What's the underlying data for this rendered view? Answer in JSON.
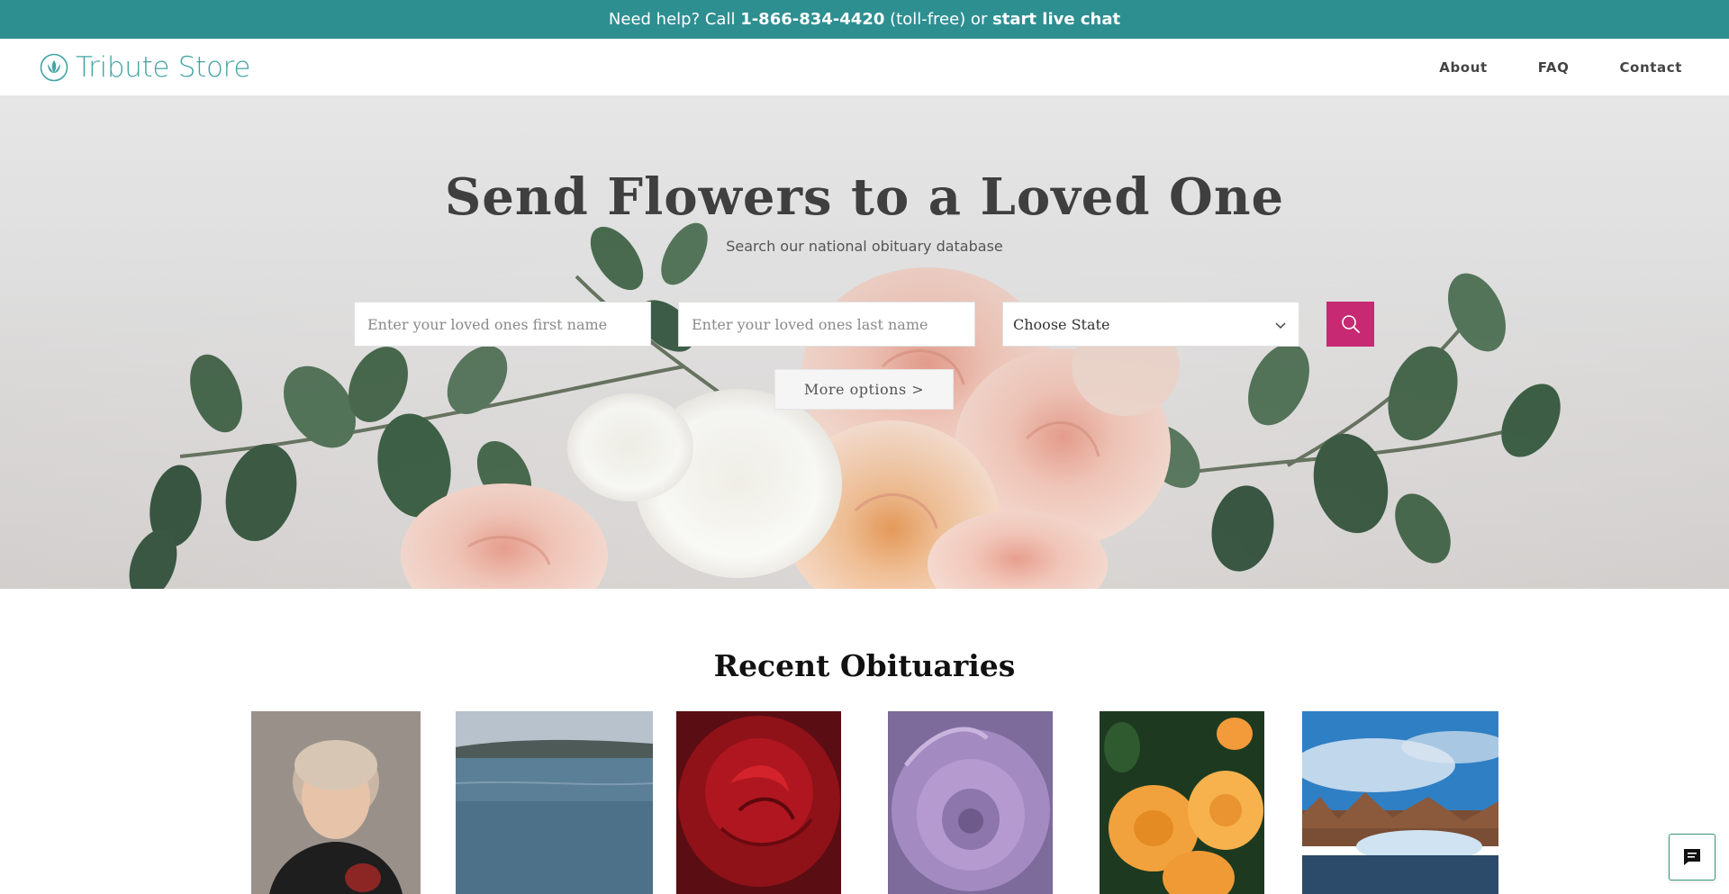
{
  "helpbar": {
    "prefix": "Need help? Call",
    "phone": "1-866-834-4420",
    "middle": "(toll-free) or",
    "chat_link": "start live chat"
  },
  "nav": {
    "logo_text": "Tribute Store",
    "links": [
      "About",
      "FAQ",
      "Contact"
    ]
  },
  "hero": {
    "title": "Send Flowers to a Loved One",
    "subtitle": "Search our national obituary database",
    "first_name_placeholder": "Enter your loved ones first name",
    "last_name_placeholder": "Enter your loved ones last name",
    "state_selected": "Choose State",
    "more_options": "More options >"
  },
  "recent": {
    "title": "Recent Obituaries",
    "items": [
      {
        "image": "portrait-photo"
      },
      {
        "image": "lake-photo"
      },
      {
        "image": "red-rose-photo"
      },
      {
        "image": "succulent-photo"
      },
      {
        "image": "orange-roses-photo"
      },
      {
        "image": "winter-river-photo"
      }
    ]
  },
  "colors": {
    "brand_teal": "#2e8f91",
    "logo_teal": "#43a4a5",
    "search_magenta": "#c72a72"
  },
  "icons": [
    "lotus-logo-icon",
    "search-icon",
    "chevron-down-icon",
    "chat-icon"
  ]
}
